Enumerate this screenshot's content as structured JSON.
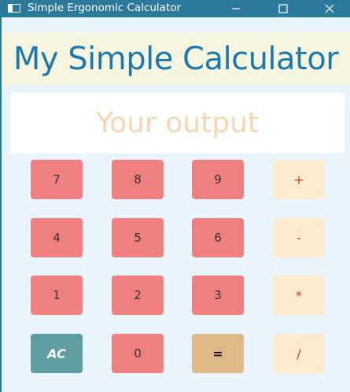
{
  "window": {
    "title": "Simple Ergonomic Calculator"
  },
  "header": {
    "title": "My Simple Calculator"
  },
  "display": {
    "placeholder": "Your output"
  },
  "keys": {
    "seven": "7",
    "eight": "8",
    "nine": "9",
    "plus": "+",
    "four": "4",
    "five": "5",
    "six": "6",
    "minus": "-",
    "one": "1",
    "two": "2",
    "three": "3",
    "multiply": "*",
    "clear": "AC",
    "zero": "0",
    "equals": "=",
    "divide": "/"
  },
  "colors": {
    "titlebar": "#2b7a9b",
    "background": "#eaf4fc",
    "header_background": "#f6f6e0",
    "header_text": "#1d78ad",
    "output_placeholder": "#f5d6b0",
    "number_key": "#f08080",
    "operator_key": "#fdebd0",
    "operator_text": "#d33a2c",
    "clear_key": "#5f9ea0",
    "equals_key": "#deb887"
  }
}
